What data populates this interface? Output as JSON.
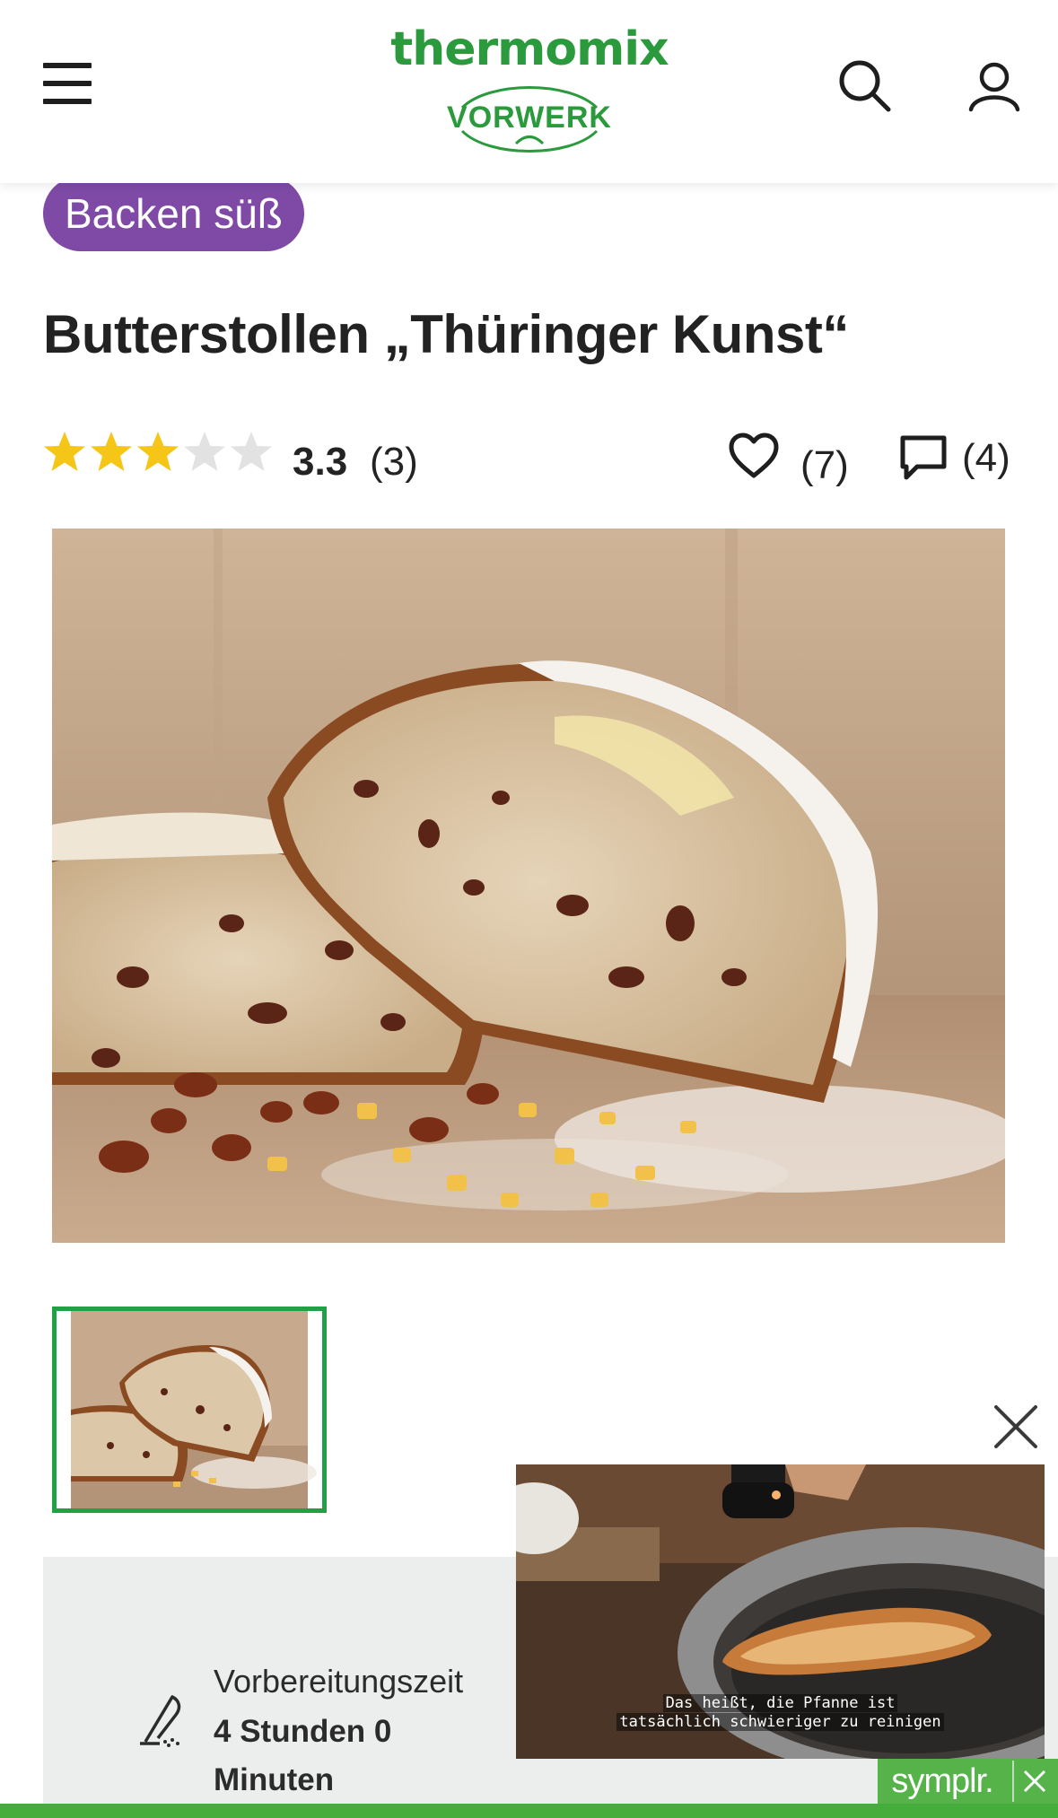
{
  "header": {
    "logo_brand": "thermomix",
    "logo_maker": "VORWERK",
    "menu_icon": "hamburger-icon",
    "search_icon": "search-icon",
    "account_icon": "user-icon",
    "brand_color": "#2a9a3c"
  },
  "recipe": {
    "category": "Backen süß",
    "category_color": "#7e4aa6",
    "title": "Butterstollen „Thüringer Kunst“",
    "rating_value": "3.3",
    "rating_stars": 3,
    "rating_max": 5,
    "rating_count": "(3)",
    "favorites_count": "(7)",
    "comments_count": "(4)"
  },
  "gallery": {
    "main_image": "stollen-photo",
    "thumbnail_selected": 0,
    "thumbnail_border_color": "#22a045"
  },
  "info": {
    "prep_label": "Vorbereitungszeit",
    "prep_value": "4 Stunden 0 Minuten",
    "prep_icon": "knife-icon"
  },
  "video_ad": {
    "subtitle_line1": "Das heißt, die Pfanne ist",
    "subtitle_line2": "tatsächlich schwieriger zu reinigen",
    "close_icon": "close-icon",
    "sponsor_logo": "symplr.",
    "sponsor_color": "#56b34a"
  }
}
